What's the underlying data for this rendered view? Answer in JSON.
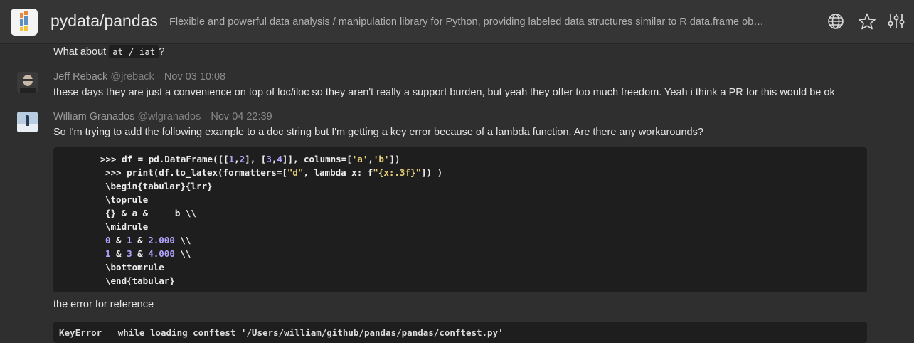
{
  "header": {
    "repo_name": "pydata/pandas",
    "description": "Flexible and powerful data analysis / manipulation library for Python, providing labeled data structures similar to R data.frame ob…",
    "icons": [
      "globe-icon",
      "star-icon",
      "settings-sliders-icon"
    ]
  },
  "messages": {
    "prev_text_prefix": "What about",
    "prev_code": "at / iat",
    "prev_text_suffix": "?",
    "reply1": {
      "author": "Jeff Reback",
      "handle": "@jreback",
      "time": "Nov 03 10:08",
      "text": "these days they are just a convenience on top of loc/iloc so they aren't really a support burden, but yeah they offer too much freedom. Yeah i think a PR for this would be ok"
    },
    "reply2": {
      "author": "William Granados",
      "handle": "@wlgranados",
      "time": "Nov 04 22:39",
      "text": "So I'm trying to add the following example to a doc string but I'm getting a key error because of a lambda function. Are there any workarounds?",
      "after_code_text": "the error for reference"
    }
  },
  "code": {
    "line1_a": ">>> df = pd.DataFrame([[",
    "line1_n1": "1",
    "line1_c1": ",",
    "line1_n2": "2",
    "line1_b": "], [",
    "line1_n3": "3",
    "line1_c2": ",",
    "line1_n4": "4",
    "line1_c": "]], columns=[",
    "line1_s1": "'a'",
    "line1_c3": ",",
    "line1_s2": "'b'",
    "line1_d": "])",
    "line2_a": ">>> print(df.to_latex(formatters=[",
    "line2_s1": "\"d\"",
    "line2_b": ", lambda x: f",
    "line2_s2": "\"{x:.3f}\"",
    "line2_c": "]) )",
    "line3": "\\begin{tabular}{lrr}",
    "line4": "\\toprule",
    "line5": "{} & a &     b \\\\",
    "line6": "\\midrule",
    "line7_n1": "0",
    "line7_a": " & ",
    "line7_n2": "1",
    "line7_b": " & ",
    "line7_n3": "2.000",
    "line7_c": " \\\\",
    "line8_n1": "1",
    "line8_a": " & ",
    "line8_n2": "3",
    "line8_b": " & ",
    "line8_n3": "4.000",
    "line8_c": " \\\\",
    "line9": "\\bottomrule",
    "line10": "\\end{tabular}",
    "partial_next": "KeyError   while loading conftest '/Users/william/github/pandas/pandas/conftest.py'"
  },
  "colors": {
    "background": "#2f2f2f",
    "header": "#353535",
    "code_bg": "#1e1e1e",
    "number": "#b3a3ff",
    "string": "#e8d27a"
  }
}
